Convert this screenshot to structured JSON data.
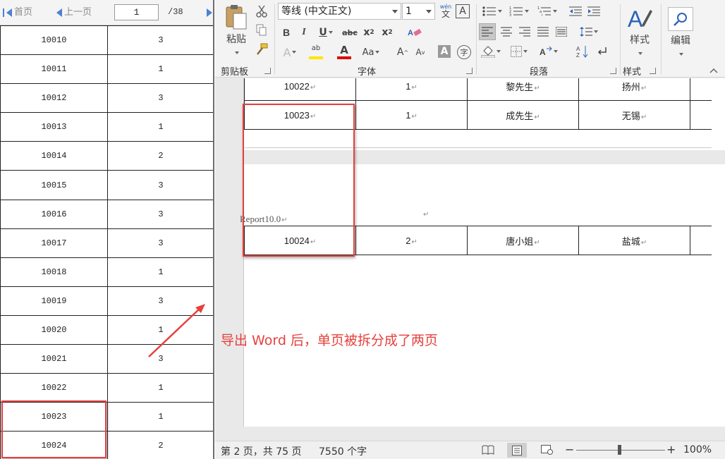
{
  "left_viewer": {
    "toolbar": {
      "first_page": "首页",
      "prev_page": "上一页",
      "page_number": "1",
      "page_total": "/38"
    },
    "rows": [
      {
        "id": "10010",
        "value": "3"
      },
      {
        "id": "10011",
        "value": "1"
      },
      {
        "id": "10012",
        "value": "3"
      },
      {
        "id": "10013",
        "value": "1"
      },
      {
        "id": "10014",
        "value": "2"
      },
      {
        "id": "10015",
        "value": "3"
      },
      {
        "id": "10016",
        "value": "3"
      },
      {
        "id": "10017",
        "value": "3"
      },
      {
        "id": "10018",
        "value": "1"
      },
      {
        "id": "10019",
        "value": "3"
      },
      {
        "id": "10020",
        "value": "1"
      },
      {
        "id": "10021",
        "value": "3"
      },
      {
        "id": "10022",
        "value": "1"
      },
      {
        "id": "10023",
        "value": "1"
      },
      {
        "id": "10024",
        "value": "2"
      }
    ]
  },
  "ribbon": {
    "clipboard": {
      "paste": "粘贴",
      "group": "剪贴板"
    },
    "font": {
      "name": "等线 (中文正文)",
      "size": "1",
      "group": "字体",
      "wen_label": "wén",
      "wen_char": "文"
    },
    "paragraph": {
      "group": "段落"
    },
    "styles": {
      "label": "样式",
      "group": "样式"
    },
    "editing": {
      "label": "编辑"
    }
  },
  "document": {
    "page1_rows": [
      {
        "id": "10022",
        "value": "1",
        "name": "黎先生",
        "city": "扬州"
      },
      {
        "id": "10023",
        "value": "1",
        "name": "成先生",
        "city": "无锡"
      }
    ],
    "page2_header": "Report10.0",
    "page2_rows": [
      {
        "id": "10024",
        "value": "2",
        "name": "唐小姐",
        "city": "盐城"
      }
    ]
  },
  "statusbar": {
    "page_info": "第 2 页，共 75 页",
    "word_count": "7550 个字",
    "zoom": "100%"
  },
  "annotation": {
    "text": "导出 Word 后，单页被拆分成了两页",
    "color": "#e5413d"
  }
}
